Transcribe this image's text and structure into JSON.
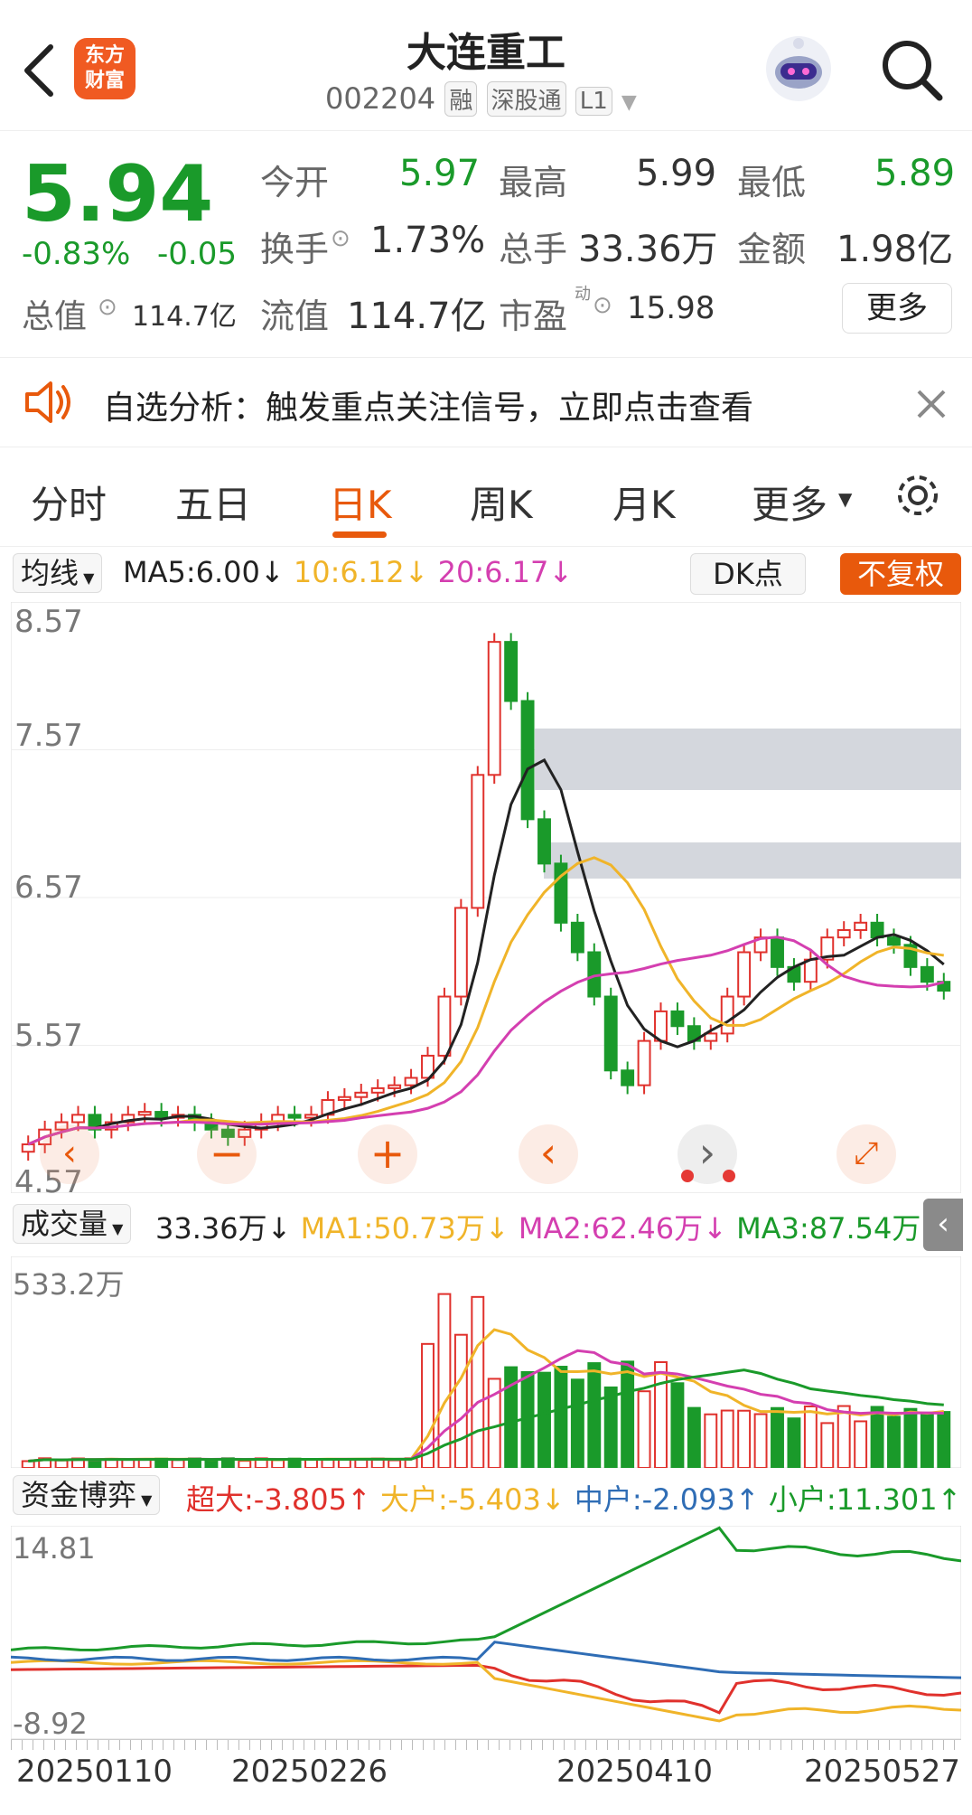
{
  "header": {
    "title": "大连重工",
    "code": "002204",
    "tags": [
      "融",
      "深股通",
      "L1"
    ],
    "logo_line1": "东方",
    "logo_line2": "财富",
    "back_icon": "back-arrow-icon",
    "search_icon": "search-icon",
    "avatar_icon": "robot-avatar-icon"
  },
  "quote": {
    "price": "5.94",
    "change_pct": "-0.83%",
    "change": "-0.05",
    "open_label": "今开",
    "open": "5.97",
    "high_label": "最高",
    "high": "5.99",
    "low_label": "最低",
    "low": "5.89",
    "turnover_label": "换手",
    "turnover": "1.73%",
    "volume_label": "总手",
    "volume": "33.36万",
    "amount_label": "金额",
    "amount": "1.98亿",
    "mktcap_label": "总值",
    "mktcap": "114.7亿",
    "float_label": "流值",
    "float": "114.7亿",
    "pe_label": "市盈",
    "pe_sup": "动",
    "pe": "15.98",
    "more_label": "更多"
  },
  "notice": {
    "text": "自选分析：触发重点关注信号，立即点击查看"
  },
  "tabs": {
    "items": [
      "分时",
      "五日",
      "日K",
      "周K",
      "月K",
      "更多"
    ],
    "active": "日K"
  },
  "ma_bar": {
    "selector": "均线",
    "ma5": "MA5:6.00",
    "ma10": "10:6.12",
    "ma20": "20:6.17",
    "dk": "DK点",
    "adjust": "不复权"
  },
  "kline_axis": [
    "8.57",
    "7.57",
    "6.57",
    "5.57",
    "4.57"
  ],
  "volume_bar": {
    "selector": "成交量",
    "vol": "33.36万",
    "ma1": "MA1:50.73万",
    "ma2": "MA2:62.46万",
    "ma3": "MA3:87.54万",
    "max": "533.2万"
  },
  "fund_bar": {
    "selector": "资金博弈",
    "super": "超大:-3.805",
    "big": "大户:-5.403",
    "mid": "中户:-2.093",
    "small": "小户:11.301",
    "max": "14.81",
    "min": "-8.92"
  },
  "dates": [
    "20250110",
    "20250226",
    "20250410",
    "20250527"
  ],
  "colors": {
    "up": "#e0312c",
    "down": "#1a9a2a",
    "ma5": "#222222",
    "ma10": "#f0b429",
    "ma20": "#d43fb0",
    "accent": "#e8590c"
  },
  "chart_data": [
    {
      "type": "line",
      "title": "",
      "y_axis_labels": [
        "8.57",
        "7.57",
        "6.57",
        "5.57",
        "4.57"
      ],
      "ylim": [
        4.57,
        8.57
      ],
      "x_labels": [
        "20250110",
        "20250226",
        "20250410",
        "20250527"
      ],
      "series": [
        {
          "name": "MA5",
          "last": 6.0
        },
        {
          "name": "10",
          "last": 6.12
        },
        {
          "name": "20",
          "last": 6.17
        }
      ],
      "close_approx": [
        4.9,
        5.0,
        5.05,
        5.1,
        5.0,
        5.05,
        5.1,
        5.12,
        5.08,
        5.1,
        5.05,
        5.0,
        4.95,
        5.0,
        5.05,
        5.1,
        5.08,
        5.1,
        5.2,
        5.22,
        5.25,
        5.28,
        5.3,
        5.35,
        5.5,
        5.9,
        6.5,
        7.4,
        8.3,
        7.9,
        7.1,
        6.8,
        6.4,
        6.2,
        5.9,
        5.4,
        5.3,
        5.6,
        5.8,
        5.7,
        5.6,
        5.65,
        5.9,
        6.2,
        6.3,
        6.1,
        6.0,
        6.15,
        6.3,
        6.35,
        6.4,
        6.3,
        6.25,
        6.1,
        6.0,
        5.94
      ]
    },
    {
      "type": "bar",
      "title": "",
      "y_max_label": "533.2万",
      "series": [
        {
          "name": "MA1",
          "last": "50.73万"
        },
        {
          "name": "MA2",
          "last": "62.46万"
        },
        {
          "name": "MA3",
          "last": "87.54万"
        }
      ]
    },
    {
      "type": "line",
      "title": "",
      "ylim": [
        -8.92,
        14.81
      ],
      "series": [
        {
          "name": "超大",
          "last": -3.805
        },
        {
          "name": "大户",
          "last": -5.403
        },
        {
          "name": "中户",
          "last": -2.093
        },
        {
          "name": "小户",
          "last": 11.301
        }
      ]
    }
  ]
}
